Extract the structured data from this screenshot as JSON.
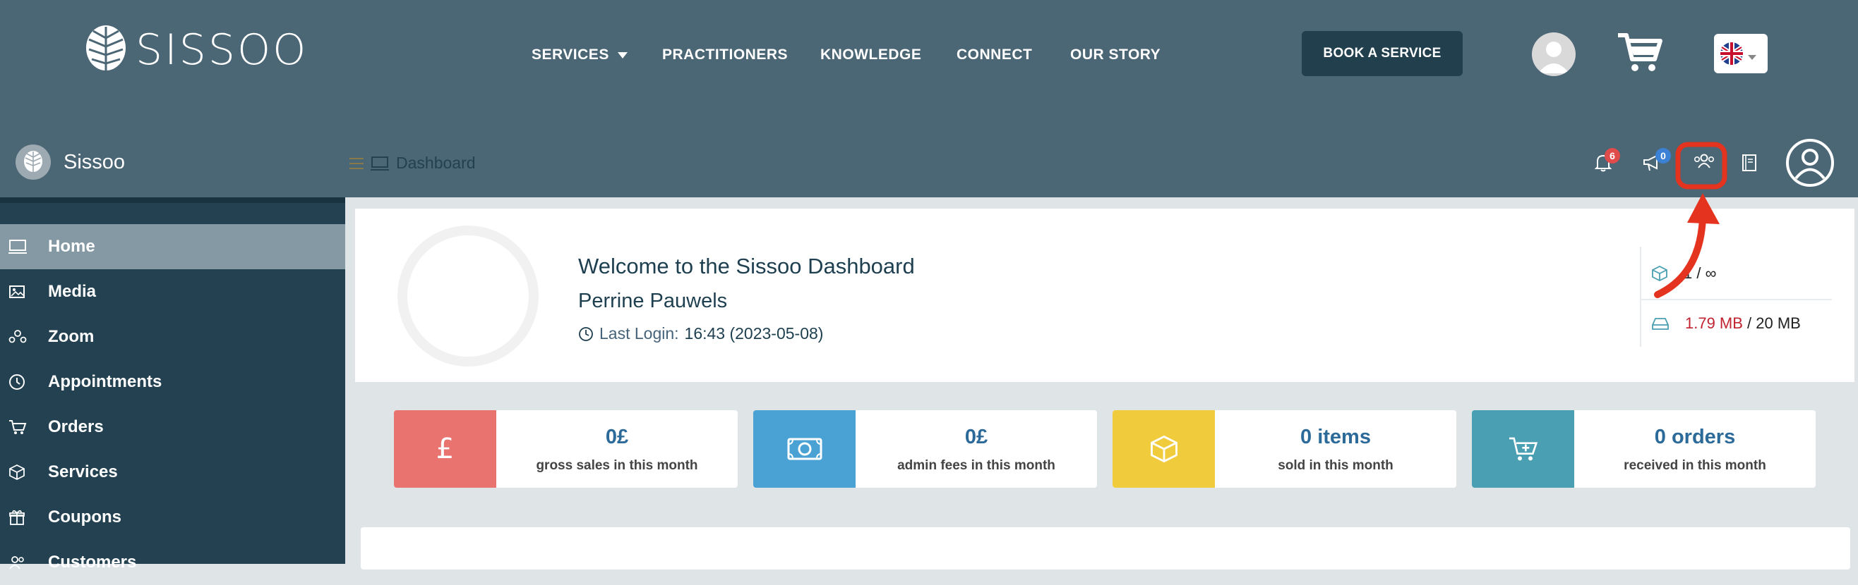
{
  "brand": {
    "name": "SISSOO"
  },
  "nav": {
    "items": [
      "SERVICES",
      "PRACTITIONERS",
      "KNOWLEDGE",
      "CONNECT",
      "OUR STORY"
    ],
    "book_label": "BOOK A SERVICE"
  },
  "sidebar": {
    "title": "Sissoo",
    "items": [
      {
        "label": "Home",
        "icon": "monitor-icon",
        "active": true
      },
      {
        "label": "Media",
        "icon": "image-icon"
      },
      {
        "label": "Zoom",
        "icon": "group-icon"
      },
      {
        "label": "Appointments",
        "icon": "clock-icon"
      },
      {
        "label": "Orders",
        "icon": "cart-icon"
      },
      {
        "label": "Services",
        "icon": "cube-icon"
      },
      {
        "label": "Coupons",
        "icon": "gift-icon"
      },
      {
        "label": "Customers",
        "icon": "users-icon"
      }
    ]
  },
  "header": {
    "breadcrumb": "Dashboard",
    "notifications_count": "6",
    "announcements_count": "0"
  },
  "welcome": {
    "title": "Welcome to the Sissoo Dashboard",
    "name": "Perrine Pauwels",
    "last_login_label": "Last Login:",
    "last_login_value": "16:43 (2023-05-08)"
  },
  "quota": {
    "products": "1 / ∞",
    "storage_used": "1.79 MB",
    "storage_total": " / 20 MB"
  },
  "stats": [
    {
      "value": "0£",
      "label": "gross sales in this month",
      "color": "#e8736f",
      "icon": "pound-icon"
    },
    {
      "value": "0£",
      "label": "admin fees in this month",
      "color": "#4aa1d3",
      "icon": "money-icon"
    },
    {
      "value": "0 items",
      "label": "sold in this month",
      "color": "#f0cc3c",
      "icon": "cube-icon"
    },
    {
      "value": "0 orders",
      "label": "received in this month",
      "color": "#4a9fb3",
      "icon": "cart-icon"
    }
  ],
  "colors": {
    "topbar": "#4b6674",
    "sidebar": "#234150",
    "accent": "#213f4c",
    "annotation": "#e4331f"
  }
}
